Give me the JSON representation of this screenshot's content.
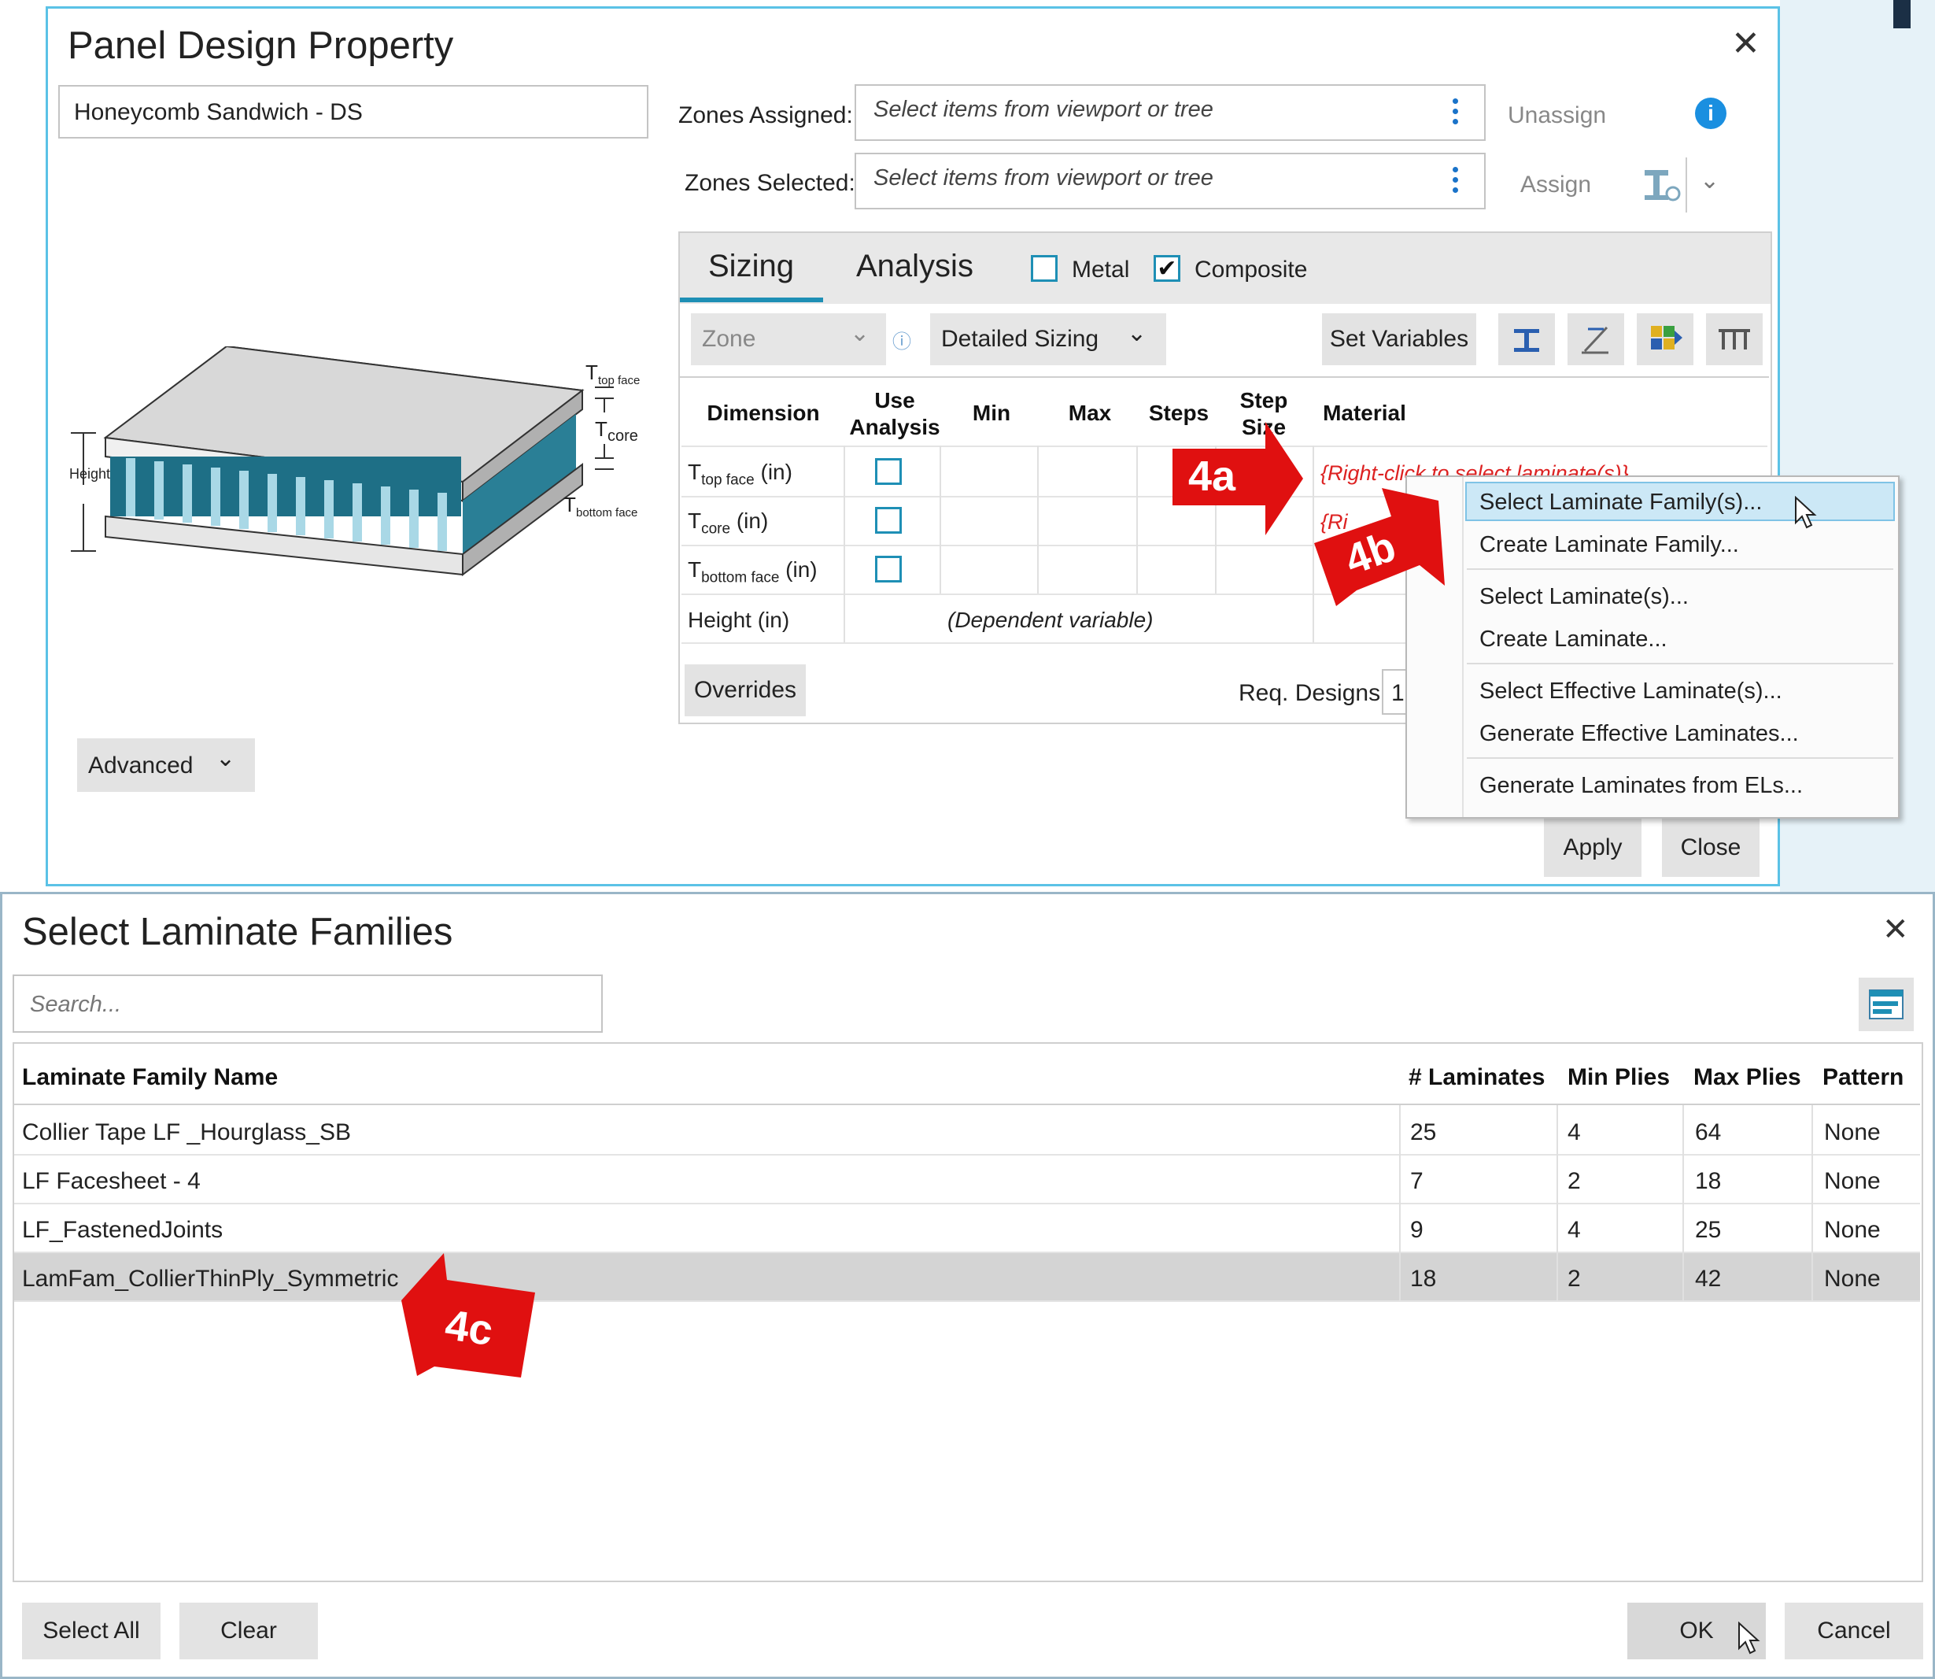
{
  "panel_dialog": {
    "title": "Panel Design Property",
    "name_value": "Honeycomb Sandwich - DS",
    "zones_assigned_label": "Zones Assigned:",
    "zones_selected_label": "Zones Selected:",
    "zones_placeholder": "Select items from viewport or tree",
    "unassign_label": "Unassign",
    "assign_label": "Assign",
    "tabs": [
      "Sizing",
      "Analysis"
    ],
    "metal_label": "Metal",
    "composite_label": "Composite",
    "zone_dropdown": "Zone",
    "sizing_dropdown": "Detailed Sizing",
    "set_variables_label": "Set Variables",
    "headers": {
      "dimension": "Dimension",
      "use": "Use",
      "analysis": "Analysis",
      "min": "Min",
      "max": "Max",
      "steps": "Steps",
      "step": "Step",
      "size": "Size",
      "material": "Material"
    },
    "rows": [
      {
        "dim_main": "T",
        "dim_sub": "top face",
        "dim_unit": " (in)"
      },
      {
        "dim_main": "T",
        "dim_sub": "core",
        "dim_unit": " (in)"
      },
      {
        "dim_main": "T",
        "dim_sub": "bottom face",
        "dim_unit": " (in)"
      },
      {
        "dim_main": "Height (in)",
        "dim_sub": "",
        "dim_unit": ""
      }
    ],
    "dependent_variable": "(Dependent variable)",
    "material_hint": "{Right-click to select laminate(s)}",
    "material_hint2": "{Ri",
    "overrides_label": "Overrides",
    "req_designs_label": "Req. Designs",
    "req_designs_value": "1",
    "advanced_label": "Advanced",
    "apply_label": "Apply",
    "close_label": "Close",
    "diagram_labels": {
      "t": "T",
      "top": "top face",
      "core": "core",
      "bottom": "bottom face",
      "height": "Height"
    }
  },
  "context_menu": [
    "Select Laminate Family(s)...",
    "Create Laminate Family...",
    "Select Laminate(s)...",
    "Create Laminate...",
    "Select Effective Laminate(s)...",
    "Generate Effective Laminates...",
    "Generate Laminates from ELs..."
  ],
  "callouts": {
    "a": "4a",
    "b": "4b",
    "c": "4c"
  },
  "laminate_dialog": {
    "title": "Select Laminate Families",
    "search_placeholder": "Search...",
    "columns": [
      "Laminate Family Name",
      "# Laminates",
      "Min Plies",
      "Max Plies",
      "Pattern"
    ],
    "rows": [
      [
        "Collier Tape LF _Hourglass_SB",
        "25",
        "4",
        "64",
        "None"
      ],
      [
        "LF Facesheet - 4",
        "7",
        "2",
        "18",
        "None"
      ],
      [
        "LF_FastenedJoints",
        "9",
        "4",
        "25",
        "None"
      ],
      [
        "LamFam_CollierThinPly_Symmetric",
        "18",
        "2",
        "42",
        "None"
      ]
    ],
    "select_all_label": "Select All",
    "clear_label": "Clear",
    "ok_label": "OK",
    "cancel_label": "Cancel"
  },
  "colors": {
    "accent": "#1e8fb5",
    "callout": "#e01010",
    "info": "#1a8fe0",
    "menu_highlight": "#cce8f6"
  }
}
